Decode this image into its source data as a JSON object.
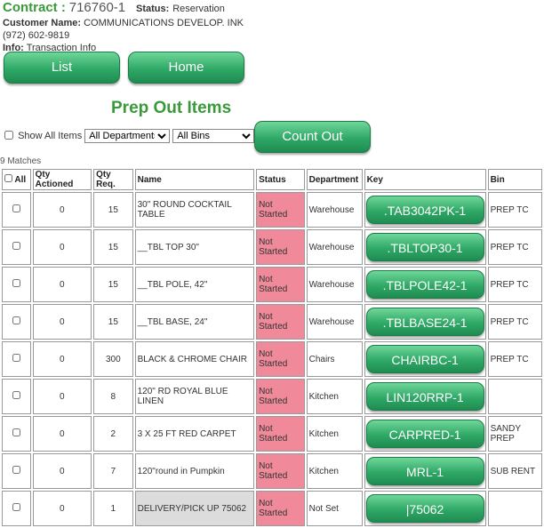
{
  "header": {
    "contract_label": "Contract :",
    "contract_number": "716760-1",
    "status_label": "Status:",
    "status_value": "Reservation",
    "customer_label": "Customer Name:",
    "customer_name": "COMMUNICATIONS DEVELOP. INK",
    "phone": "(972) 602-9819",
    "info_label": "Info:",
    "info_value": "Transaction Info"
  },
  "nav": {
    "list_label": "List",
    "home_label": "Home"
  },
  "title": "Prep Out Items",
  "filters": {
    "show_all_label": "Show All Items",
    "department_selected": "All Departments",
    "bin_selected": "All Bins",
    "count_out_label": "Count Out"
  },
  "matches": "9 Matches",
  "table": {
    "headers": [
      "All",
      "Qty Actioned",
      "Qty Req.",
      "Name",
      "Status",
      "Department",
      "Key",
      "Bin"
    ],
    "rows": [
      {
        "qty_actioned": "0",
        "qty_req": "15",
        "name": "30\" ROUND COCKTAIL TABLE",
        "status": "Not Started",
        "department": "Warehouse",
        "key": ".TAB3042PK-1",
        "bin": "PREP TC"
      },
      {
        "qty_actioned": "0",
        "qty_req": "15",
        "name": "__TBL TOP 30\"",
        "status": "Not Started",
        "department": "Warehouse",
        "key": ".TBLTOP30-1",
        "bin": "PREP TC"
      },
      {
        "qty_actioned": "0",
        "qty_req": "15",
        "name": "__TBL POLE, 42\"",
        "status": "Not Started",
        "department": "Warehouse",
        "key": ".TBLPOLE42-1",
        "bin": "PREP TC"
      },
      {
        "qty_actioned": "0",
        "qty_req": "15",
        "name": "__TBL BASE, 24\"",
        "status": "Not Started",
        "department": "Warehouse",
        "key": ".TBLBASE24-1",
        "bin": "PREP TC"
      },
      {
        "qty_actioned": "0",
        "qty_req": "300",
        "name": "BLACK & CHROME CHAIR",
        "status": "Not Started",
        "department": "Chairs",
        "key": "CHAIRBC-1",
        "bin": "PREP TC"
      },
      {
        "qty_actioned": "0",
        "qty_req": "8",
        "name": "120\" RD ROYAL BLUE LINEN",
        "status": "Not Started",
        "department": "Kitchen",
        "key": "LIN120RRP-1",
        "bin": ""
      },
      {
        "qty_actioned": "0",
        "qty_req": "2",
        "name": "3 X 25 FT RED CARPET",
        "status": "Not Started",
        "department": "Kitchen",
        "key": "CARPRED-1",
        "bin": "SANDY PREP"
      },
      {
        "qty_actioned": "0",
        "qty_req": "7",
        "name": "120\"round in Pumpkin",
        "status": "Not Started",
        "department": "Kitchen",
        "key": "MRL-1",
        "bin": "SUB RENT"
      },
      {
        "qty_actioned": "0",
        "qty_req": "1",
        "name": "DELIVERY/PICK UP 75062",
        "status": "Not Started",
        "department": "Not Set",
        "key": "|75062",
        "bin": ""
      }
    ]
  },
  "colors": {
    "accent_green": "#3a9a3a",
    "button_green": "#2fa866",
    "not_started": "#f08a9a"
  }
}
